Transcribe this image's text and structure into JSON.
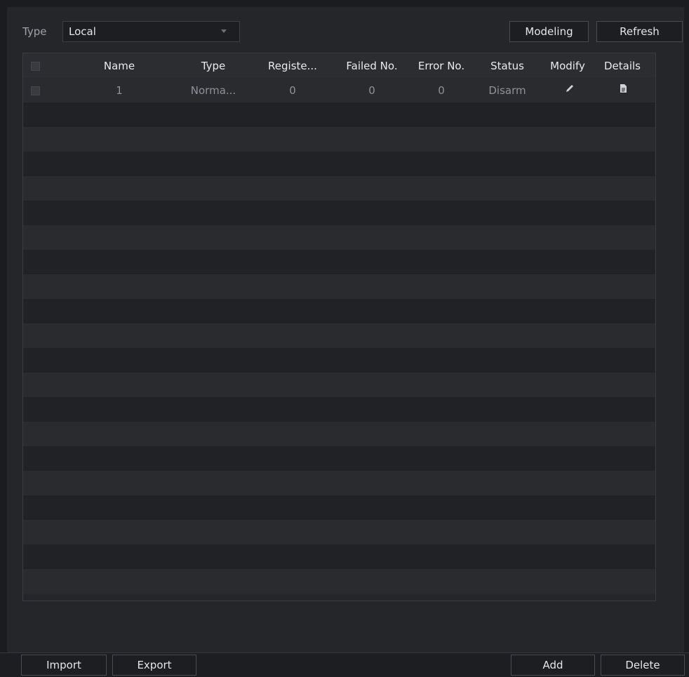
{
  "filter": {
    "type_label": "Type",
    "type_value": "Local"
  },
  "toolbar": {
    "modeling_label": "Modeling",
    "refresh_label": "Refresh"
  },
  "table": {
    "columns": [
      "Name",
      "Type",
      "Registe...",
      "Failed No.",
      "Error No.",
      "Status",
      "Modify",
      "Details"
    ],
    "rows": [
      {
        "name": "1",
        "type": "Norma...",
        "registered": "0",
        "failed": "0",
        "error": "0",
        "status": "Disarm"
      }
    ]
  },
  "footer": {
    "import_label": "Import",
    "export_label": "Export",
    "add_label": "Add",
    "delete_label": "Delete"
  },
  "icons": {
    "modify": "pencil-icon",
    "details": "document-icon",
    "dropdown": "chevron-down-icon"
  },
  "colors": {
    "background": "#1b1c1f",
    "panel": "#25262a",
    "row_odd": "#2a2b2f",
    "row_even": "#212226",
    "text": "#e4e6ea",
    "muted_text": "#8e9198"
  }
}
